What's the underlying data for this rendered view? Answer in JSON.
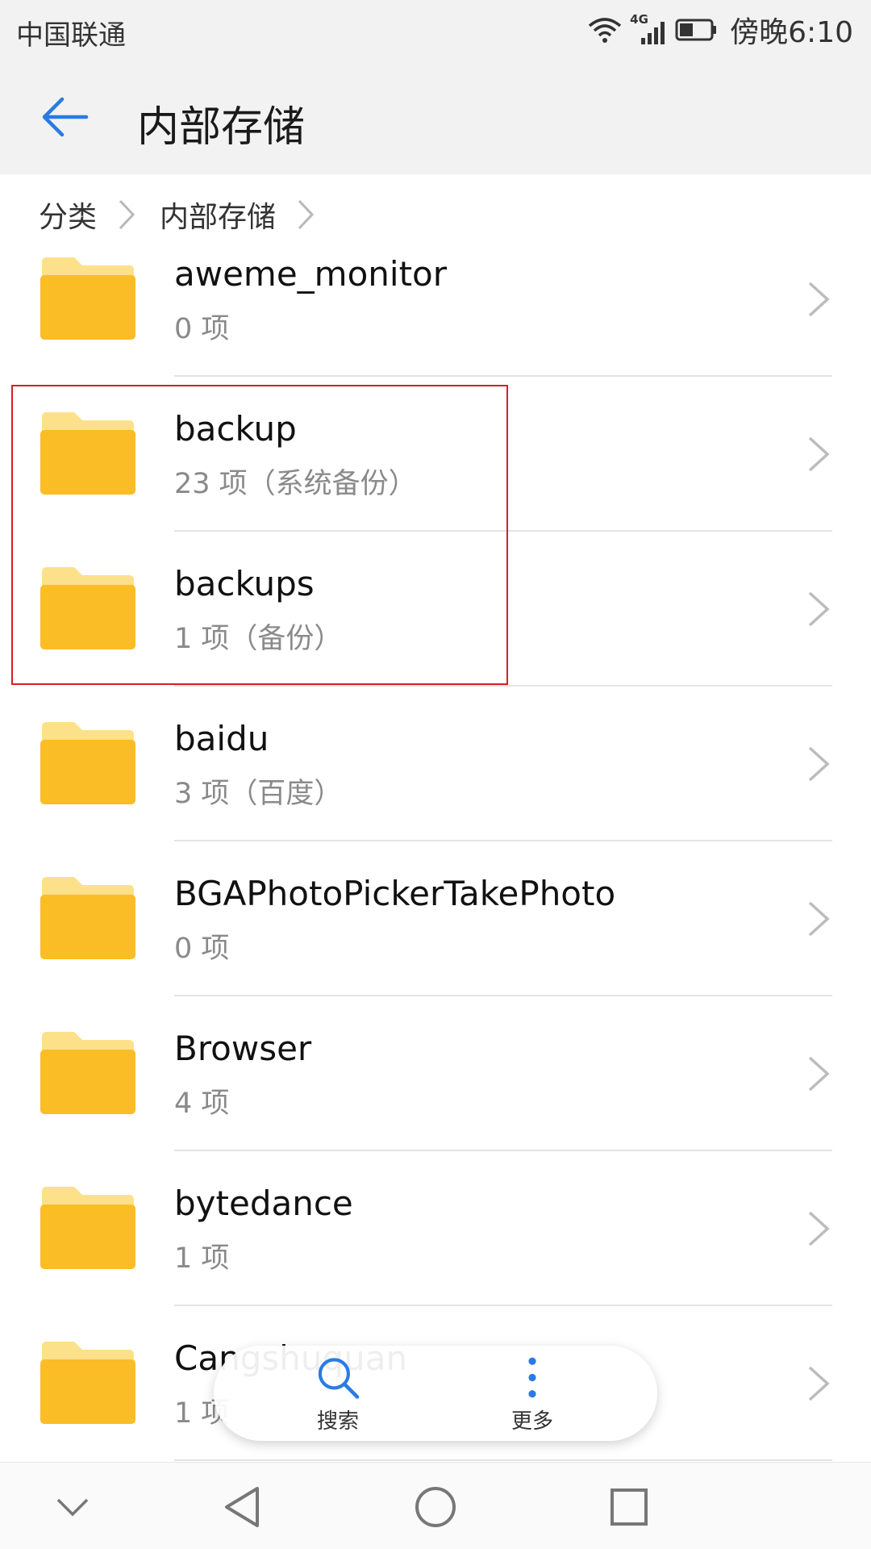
{
  "status_bar": {
    "carrier": "中国联通",
    "network": "4G",
    "time": "傍晚6:10"
  },
  "header": {
    "title": "内部存储",
    "back_icon": "arrow-left-icon"
  },
  "breadcrumb": [
    {
      "label": "分类"
    },
    {
      "label": "内部存储"
    }
  ],
  "folders": [
    {
      "name": "aweme_monitor",
      "sub": "0 项"
    },
    {
      "name": "backup",
      "sub": "23 项（系统备份）"
    },
    {
      "name": "backups",
      "sub": "1 项（备份）"
    },
    {
      "name": "baidu",
      "sub": "3 项（百度）"
    },
    {
      "name": "BGAPhotoPickerTakePhoto",
      "sub": "0 项"
    },
    {
      "name": "Browser",
      "sub": "4 项"
    },
    {
      "name": "bytedance",
      "sub": "1 项"
    },
    {
      "name": "Cangshuquan",
      "sub": "1 项"
    }
  ],
  "toolbar": {
    "search_label": "搜索",
    "more_label": "更多"
  },
  "colors": {
    "accent": "#2a7be4",
    "folder": "#fbbd25",
    "folder_tab": "#fde08a",
    "highlight": "#d32222"
  }
}
